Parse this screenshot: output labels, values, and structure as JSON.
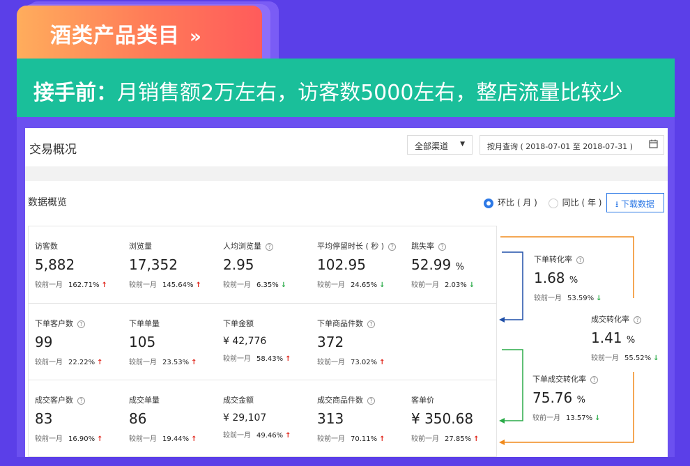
{
  "header": {
    "tab_title": "酒类产品类目",
    "tab_chevron": "»",
    "banner_strong": "接手前：",
    "banner_text": "月销售额2万左右，访客数5000左右，整店流量比较少"
  },
  "toolbar": {
    "page_title": "交易概况",
    "channel_select": "全部渠道",
    "date_range": "按月查询 ( 2018-07-01 至 2018-07-31 )"
  },
  "overview": {
    "section_title": "数据概览",
    "radio_mom": "环比 ( 月 )",
    "radio_yoy": "同比 ( 年 )",
    "mom_selected": true,
    "download_label": "下载数据",
    "compare_label": "较前一月"
  },
  "metrics": {
    "row1": [
      {
        "label": "访客数",
        "value": "5,882",
        "change": "162.71%",
        "dir": "up",
        "help": false
      },
      {
        "label": "浏览量",
        "value": "17,352",
        "change": "145.64%",
        "dir": "up",
        "help": false
      },
      {
        "label": "人均浏览量",
        "value": "2.95",
        "change": "6.35%",
        "dir": "down",
        "help": true
      },
      {
        "label": "平均停留时长 ( 秒 )",
        "value": "102.95",
        "change": "24.65%",
        "dir": "down",
        "help": true
      },
      {
        "label": "跳失率",
        "value": "52.99",
        "unit": "%",
        "change": "2.03%",
        "dir": "down",
        "help": true
      }
    ],
    "row2": [
      {
        "label": "下单客户数",
        "value": "99",
        "change": "22.22%",
        "dir": "up",
        "help": true
      },
      {
        "label": "下单单量",
        "value": "105",
        "change": "23.53%",
        "dir": "up",
        "help": false
      },
      {
        "label": "下单金额",
        "value": "¥ 42,776",
        "change": "58.43%",
        "dir": "up",
        "help": false
      },
      {
        "label": "下单商品件数",
        "value": "372",
        "change": "73.02%",
        "dir": "up",
        "help": true
      }
    ],
    "row3": [
      {
        "label": "成交客户数",
        "value": "83",
        "change": "16.90%",
        "dir": "up",
        "help": true
      },
      {
        "label": "成交单量",
        "value": "86",
        "change": "19.44%",
        "dir": "up",
        "help": false
      },
      {
        "label": "成交金额",
        "value": "¥ 29,107",
        "change": "49.46%",
        "dir": "up",
        "help": false
      },
      {
        "label": "成交商品件数",
        "value": "313",
        "change": "70.11%",
        "dir": "up",
        "help": true
      },
      {
        "label": "客单价",
        "value": "¥ 350.68",
        "change": "27.85%",
        "dir": "up",
        "help": false
      }
    ]
  },
  "funnel": {
    "order_rate": {
      "label": "下单转化率",
      "value": "1.68",
      "unit": "%",
      "change": "53.59%",
      "dir": "down"
    },
    "deal_rate": {
      "label": "成交转化率",
      "value": "1.41",
      "unit": "%",
      "change": "55.52%",
      "dir": "down"
    },
    "order_deal_rate": {
      "label": "下单成交转化率",
      "value": "75.76",
      "unit": "%",
      "change": "13.57%",
      "dir": "down"
    }
  },
  "colors": {
    "background": "#5b3fe8",
    "banner": "#1abf9a",
    "accent_blue": "#2d79e6",
    "up_red": "#e0251b",
    "down_green": "#2aab48",
    "funnel_orange": "#f08a1c",
    "funnel_blue": "#1f4fa8",
    "funnel_green": "#2aab48"
  },
  "icons": {
    "tab_chevron": "double-chevron-right-icon",
    "calendar": "calendar-icon",
    "download": "download-icon",
    "help": "question-circle-icon",
    "arrow_up": "arrow-up-icon",
    "arrow_down": "arrow-down-icon"
  }
}
